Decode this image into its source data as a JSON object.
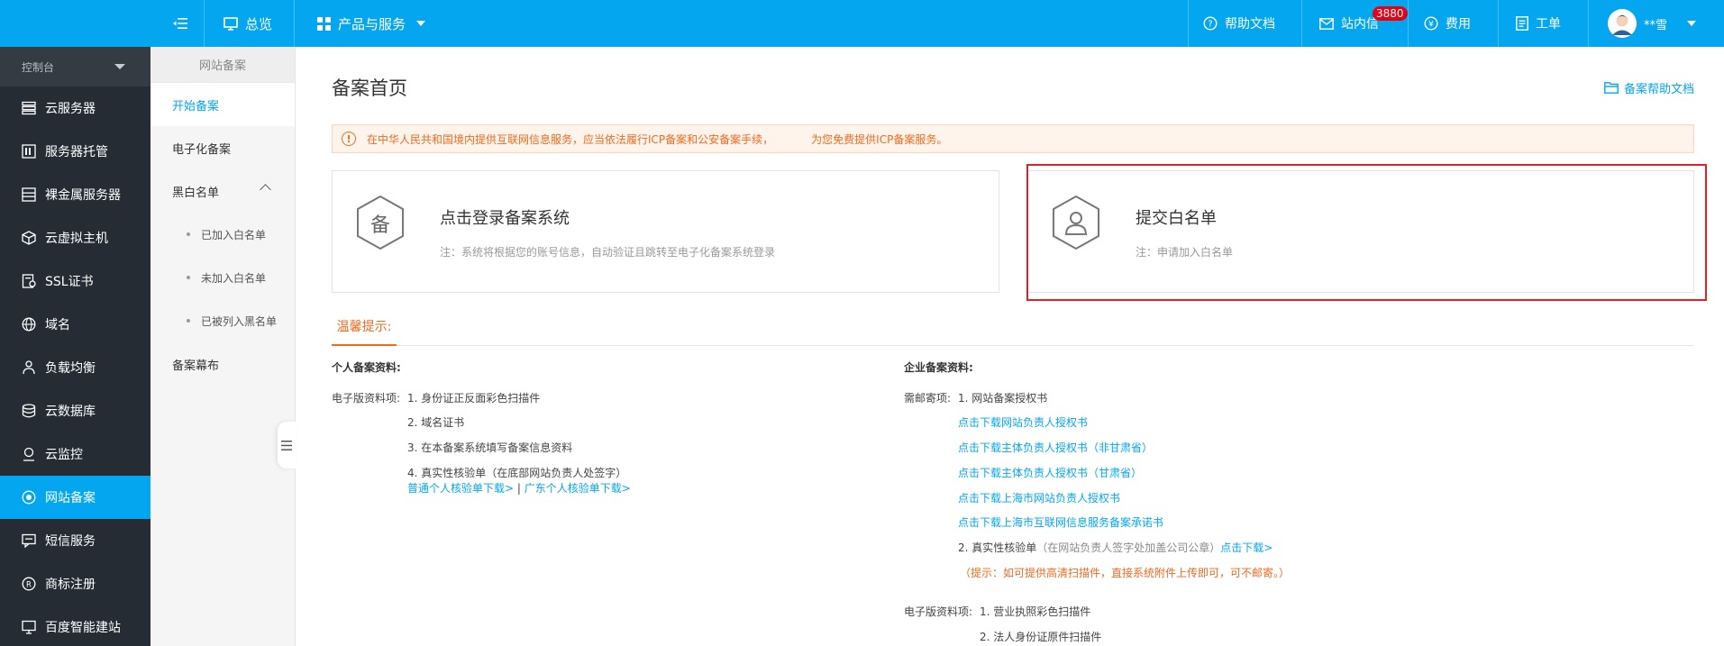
{
  "topbar": {
    "overview": "总览",
    "products": "产品与服务",
    "help_docs": "帮助文档",
    "messages": "站内信",
    "messages_badge": "3880",
    "billing": "费用",
    "tickets": "工单",
    "username": "**雪"
  },
  "sidebar": {
    "header": "控制台",
    "items": [
      {
        "label": "云服务器",
        "icon": "server-icon"
      },
      {
        "label": "服务器托管",
        "icon": "hosting-icon"
      },
      {
        "label": "裸金属服务器",
        "icon": "bare-metal-icon"
      },
      {
        "label": "云虚拟主机",
        "icon": "cube-icon"
      },
      {
        "label": "SSL证书",
        "icon": "certificate-icon"
      },
      {
        "label": "域名",
        "icon": "globe-icon"
      },
      {
        "label": "负载均衡",
        "icon": "load-balance-icon"
      },
      {
        "label": "云数据库",
        "icon": "database-icon"
      },
      {
        "label": "云监控",
        "icon": "monitor-icon"
      },
      {
        "label": "网站备案",
        "icon": "filing-icon"
      },
      {
        "label": "短信服务",
        "icon": "sms-icon"
      },
      {
        "label": "商标注册",
        "icon": "trademark-icon"
      },
      {
        "label": "百度智能建站",
        "icon": "site-builder-icon"
      }
    ]
  },
  "subnav": {
    "title": "网站备案",
    "start": "开始备案",
    "electronic": "电子化备案",
    "whitelist": "黑白名单",
    "sub": [
      "已加入白名单",
      "未加入白名单",
      "已被列入黑名单"
    ],
    "curtain": "备案幕布"
  },
  "main": {
    "title": "备案首页",
    "help_link": "备案帮助文档",
    "notice": {
      "part1": "在中华人民共和国境内提供互联网信息服务，应当依法履行ICP备案和公安备案手续，",
      "part2": "为您免费提供ICP备案服务。"
    },
    "card1": {
      "icon_char": "备",
      "title": "点击登录备案系统",
      "note": "注：系统将根据您的账号信息，自动验证且跳转至电子化备案系统登录"
    },
    "card2": {
      "title": "提交白名单",
      "note": "注：申请加入白名单"
    },
    "tips_tab": "温馨提示:",
    "personal": {
      "title": "个人备案资料:",
      "label": "电子版资料项:",
      "items": [
        "1. 身份证正反面彩色扫描件",
        "2. 域名证书",
        "3. 在本备案系统填写备案信息资料",
        "4. 真实性核验单（在底部网站负责人处签字）"
      ],
      "link1": "普通个人核验单下载>",
      "link_sep": "|",
      "link2": "广东个人核验单下载>"
    },
    "enterprise": {
      "title": "企业备案资料:",
      "mail_label": "需邮寄项:",
      "item1": "1. 网站备案授权书",
      "links": [
        "点击下载网站负责人授权书",
        "点击下载主体负责人授权书（非甘肃省）",
        "点击下载主体负责人授权书（甘肃省）",
        "点击下载上海市网站负责人授权书",
        "点击下载上海市互联网信息服务备案承诺书"
      ],
      "item2": "2. 真实性核验单",
      "item2_note": "（在网站负责人签字处加盖公司公章）",
      "item2_link": "点击下载>",
      "tip": "（提示：如可提供高清扫描件，直接系统附件上传即可，可不邮寄。）",
      "elec_label": "电子版资料项:",
      "elec_item1": "1. 营业执照彩色扫描件",
      "elec_item2": "2. 法人身份证原件扫描件"
    }
  }
}
